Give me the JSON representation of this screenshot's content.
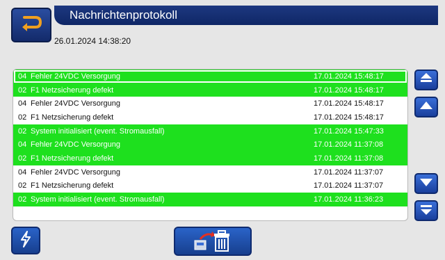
{
  "header": {
    "title": "Nachrichtenprotokoll",
    "datetime": "26.01.2024 14:38:20"
  },
  "messages": [
    {
      "code": "04",
      "text": "Fehler 24VDC Versorgung",
      "time": "17.01.2024 15:48:17",
      "style": "alert",
      "selected": true
    },
    {
      "code": "02",
      "text": "F1 Netzsicherung defekt",
      "time": "17.01.2024 15:48:17",
      "style": "alert"
    },
    {
      "code": "04",
      "text": "Fehler 24VDC Versorgung",
      "time": "17.01.2024 15:48:17",
      "style": "normal"
    },
    {
      "code": "02",
      "text": "F1 Netzsicherung defekt",
      "time": "17.01.2024 15:48:17",
      "style": "normal"
    },
    {
      "code": "02",
      "text": "System initialisiert (event. Stromausfall)",
      "time": "17.01.2024 15:47:33",
      "style": "alert"
    },
    {
      "code": "04",
      "text": "Fehler 24VDC Versorgung",
      "time": "17.01.2024 11:37:08",
      "style": "alert"
    },
    {
      "code": "02",
      "text": "F1 Netzsicherung defekt",
      "time": "17.01.2024 11:37:08",
      "style": "alert"
    },
    {
      "code": "04",
      "text": "Fehler 24VDC Versorgung",
      "time": "17.01.2024 11:37:07",
      "style": "normal"
    },
    {
      "code": "02",
      "text": "F1 Netzsicherung defekt",
      "time": "17.01.2024 11:37:07",
      "style": "normal"
    },
    {
      "code": "02",
      "text": "System initialisiert (event. Stromausfall)",
      "time": "17.01.2024 11:36:23",
      "style": "alert"
    }
  ],
  "icons": {
    "back": "return-arrow-icon",
    "scroll_top": "double-up-arrow-icon",
    "scroll_up": "up-arrow-icon",
    "scroll_down": "down-arrow-icon",
    "scroll_bottom": "double-down-arrow-icon",
    "lightning": "lightning-icon",
    "delete_log": "clear-log-trash-icon"
  },
  "colors": {
    "alert_row": "#1ee01e",
    "header": "#0f2766",
    "button": "#1a3f9c",
    "arrow": "#f0a020"
  }
}
